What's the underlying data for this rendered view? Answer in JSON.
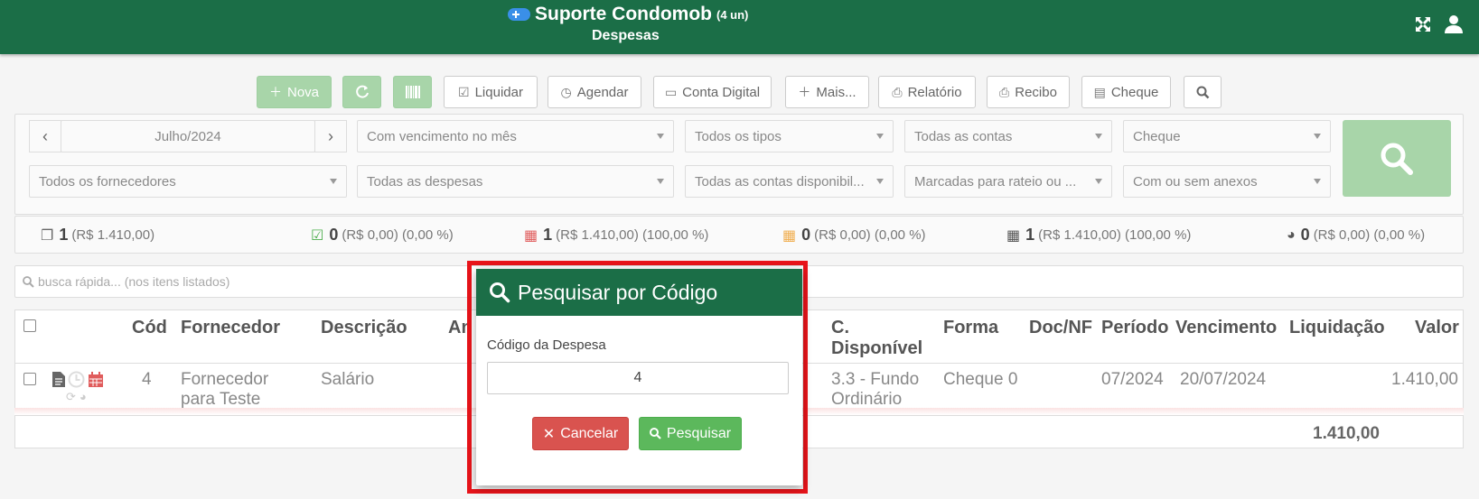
{
  "header": {
    "title": "Suporte Condomob",
    "units": "(4 un)",
    "subtitle": "Despesas"
  },
  "toolbar": {
    "nova": "Nova",
    "liquidar": "Liquidar",
    "agendar": "Agendar",
    "conta_digital": "Conta Digital",
    "mais": "Mais...",
    "relatorio": "Relatório",
    "recibo": "Recibo",
    "cheque": "Cheque"
  },
  "filters": {
    "month": "Julho/2024",
    "vencimento": "Com vencimento no mês",
    "tipos": "Todos os tipos",
    "contas": "Todas as contas",
    "forma": "Cheque",
    "fornecedores": "Todos os fornecedores",
    "despesas": "Todas as despesas",
    "contas_disp": "Todas as contas disponibil...",
    "rateio": "Marcadas para rateio ou ...",
    "anexos": "Com ou sem anexos"
  },
  "stats": [
    {
      "count": "1",
      "detail": "(R$ 1.410,00)",
      "color": "#666666"
    },
    {
      "count": "0",
      "detail": "(R$ 0,00) (0,00 %)",
      "color": "#4cae4c"
    },
    {
      "count": "1",
      "detail": "(R$ 1.410,00) (100,00 %)",
      "color": "#e05c5c"
    },
    {
      "count": "0",
      "detail": "(R$ 0,00) (0,00 %)",
      "color": "#f0ad4e"
    },
    {
      "count": "1",
      "detail": "(R$ 1.410,00) (100,00 %)",
      "color": "#555555"
    },
    {
      "count": "0",
      "detail": "(R$ 0,00) (0,00 %)",
      "color": "#555555"
    }
  ],
  "quick_search": {
    "placeholder": "busca rápida... (nos itens listados)"
  },
  "table": {
    "headers": {
      "cod": "Cód",
      "fornecedor": "Fornecedor",
      "descricao": "Descrição",
      "anexo_partial": "An",
      "disponivel_1": "C.",
      "disponivel_2": "Disponível",
      "forma": "Forma",
      "docnf": "Doc/NF",
      "periodo": "Período",
      "vencimento": "Vencimento",
      "liquidacao": "Liquidação",
      "valor": "Valor"
    },
    "row": {
      "cod": "4",
      "fornecedor_1": "Fornecedor",
      "fornecedor_2": "para Teste",
      "descricao": "Salário",
      "disponivel_1": "3.3 - Fundo",
      "disponivel_2": "Ordinário",
      "forma": "Cheque 0",
      "periodo": "07/2024",
      "vencimento": "20/07/2024",
      "valor": "1.410,00"
    },
    "total": "1.410,00"
  },
  "modal": {
    "title": "Pesquisar por Código",
    "label": "Código da Despesa",
    "value": "4",
    "cancel": "Cancelar",
    "search": "Pesquisar"
  }
}
